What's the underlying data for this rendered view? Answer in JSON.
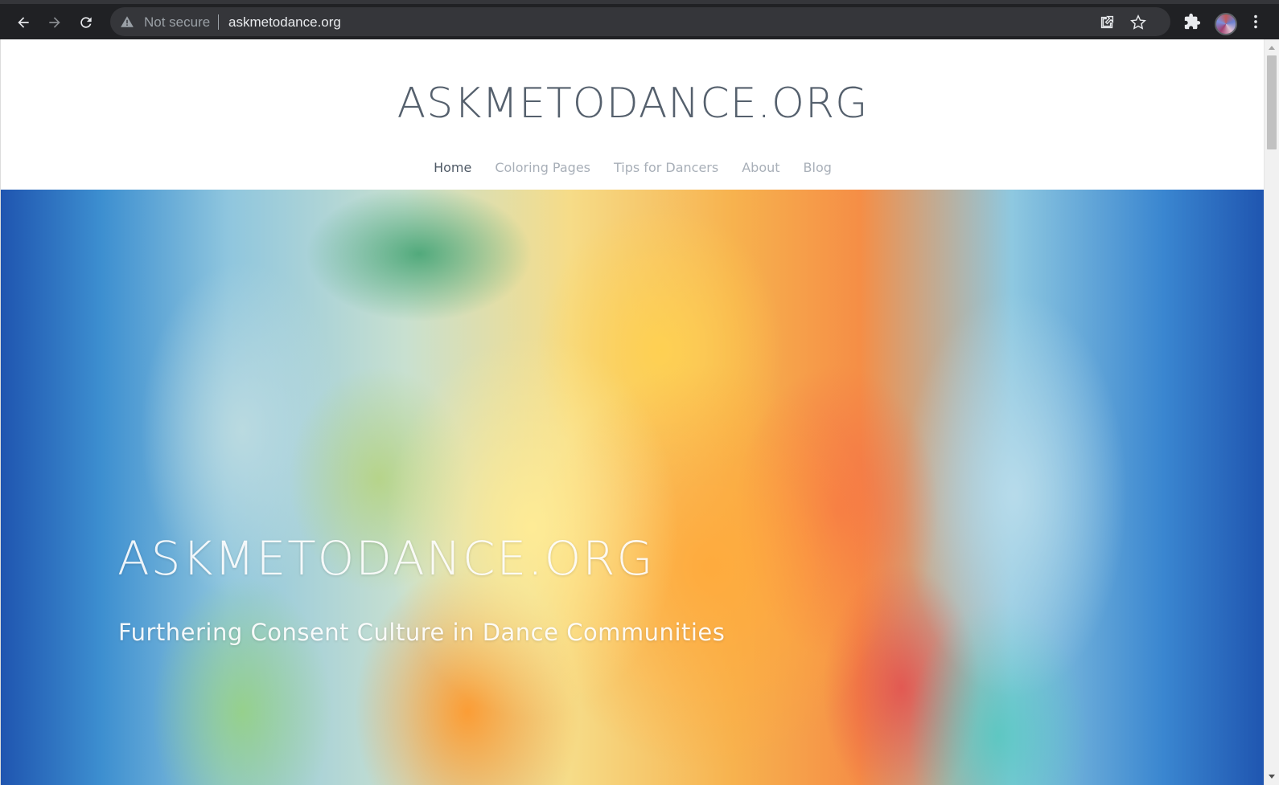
{
  "browser": {
    "security_label": "Not secure",
    "url": "askmetodance.org",
    "icons": [
      "back-arrow-icon",
      "forward-arrow-icon",
      "reload-icon",
      "warning-triangle-icon",
      "share-icon",
      "star-icon",
      "puzzle-extension-icon",
      "profile-avatar",
      "kebab-menu-icon"
    ]
  },
  "site": {
    "title": "ASKMETODANCE.ORG",
    "nav": [
      {
        "label": "Home",
        "active": true
      },
      {
        "label": "Coloring Pages",
        "active": false
      },
      {
        "label": "Tips for Dancers",
        "active": false
      },
      {
        "label": "About",
        "active": false
      },
      {
        "label": "Blog",
        "active": false
      }
    ]
  },
  "hero": {
    "title": "ASKMETODANCE.ORG",
    "subtitle": "Furthering Consent Culture in Dance Communities"
  },
  "colors": {
    "chrome_bg": "#202124",
    "omnibox_bg": "#35363a",
    "site_title": "#55606d",
    "nav_active": "#4f5a66",
    "nav_inactive": "#a8afb8"
  }
}
